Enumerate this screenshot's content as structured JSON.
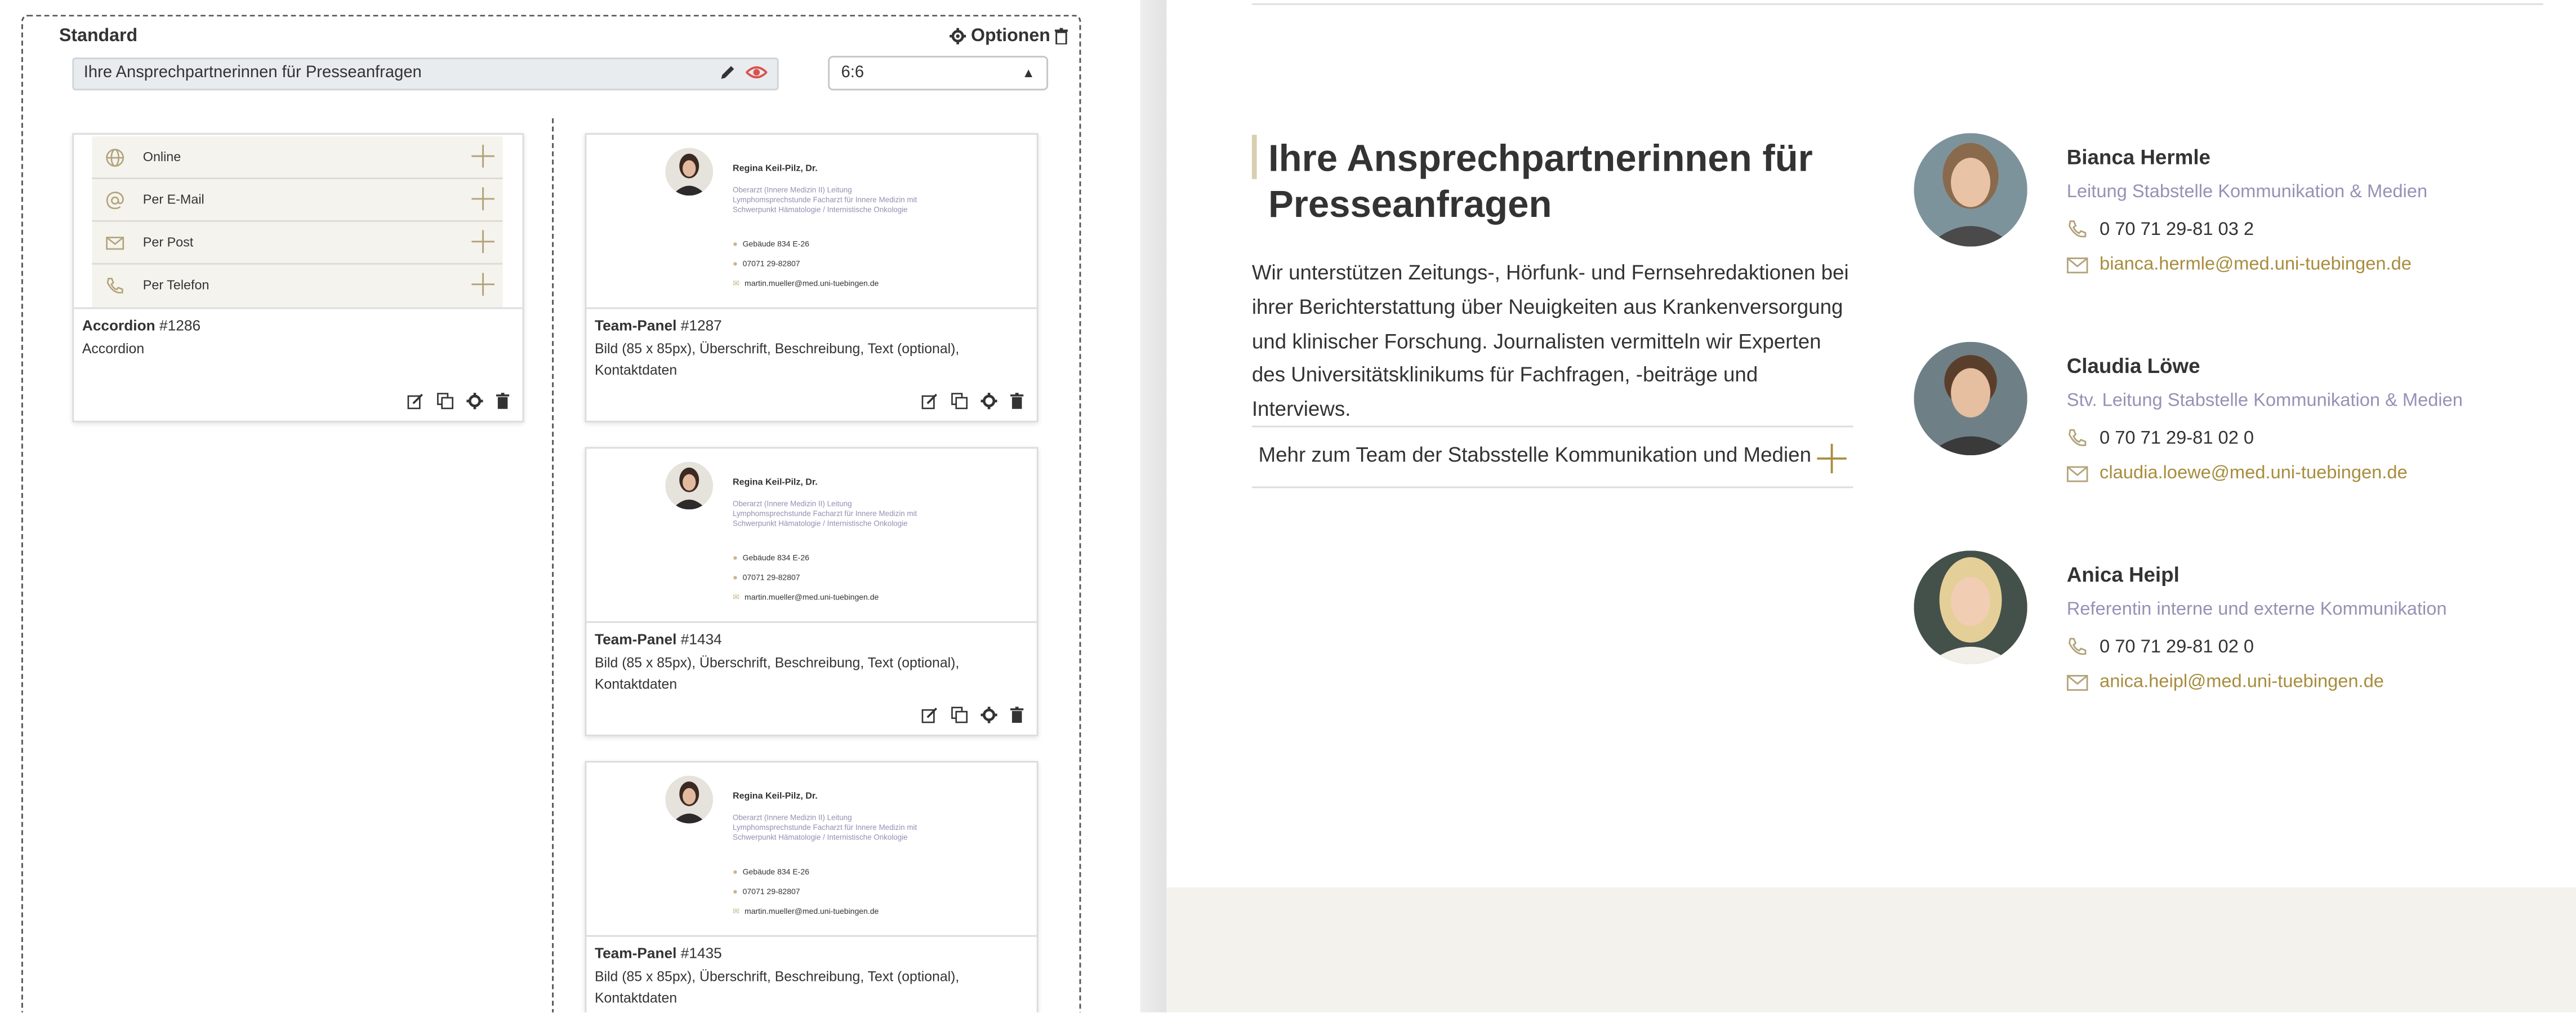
{
  "editor": {
    "grid_label": "Standard",
    "options_label": "Optionen",
    "title_value": "Ihre Ansprechpartnerinnen für Presseanfragen",
    "ratio_value": "6:6",
    "accordion_element": {
      "rows": [
        {
          "label": "Online",
          "icon": "globe-icon"
        },
        {
          "label": "Per E-Mail",
          "icon": "at-icon"
        },
        {
          "label": "Per Post",
          "icon": "envelope-icon"
        },
        {
          "label": "Per Telefon",
          "icon": "phone-icon"
        }
      ],
      "type": "Accordion",
      "id": "#1286",
      "description": "Accordion"
    },
    "team_panels": [
      {
        "type": "Team-Panel",
        "id": "#1287",
        "description": "Bild (85 x 85px), Überschrift, Beschreibung, Text (optional), Kontaktdaten",
        "preview_name": "Regina Keil-Pilz, Dr.",
        "preview_desc": "Oberarzt (Innere Medizin II) Leitung Lymphomsprechstunde Facharzt für Innere Medizin mit Schwerpunkt Hämatologie / Internistische Onkologie",
        "preview_address": "Gebäude 834 E-26",
        "preview_phone": "07071 29-82807",
        "preview_email": "martin.mueller@med.uni-tuebingen.de"
      },
      {
        "type": "Team-Panel",
        "id": "#1434",
        "description": "Bild (85 x 85px), Überschrift, Beschreibung, Text (optional), Kontaktdaten",
        "preview_name": "Regina Keil-Pilz, Dr.",
        "preview_desc": "Oberarzt (Innere Medizin II) Leitung Lymphomsprechstunde Facharzt für Innere Medizin mit Schwerpunkt Hämatologie / Internistische Onkologie",
        "preview_address": "Gebäude 834 E-26",
        "preview_phone": "07071 29-82807",
        "preview_email": "martin.mueller@med.uni-tuebingen.de"
      },
      {
        "type": "Team-Panel",
        "id": "#1435",
        "description": "Bild (85 x 85px), Überschrift, Beschreibung, Text (optional), Kontaktdaten",
        "preview_name": "Regina Keil-Pilz, Dr.",
        "preview_desc": "Oberarzt (Innere Medizin II) Leitung Lymphomsprechstunde Facharzt für Innere Medizin mit Schwerpunkt Hämatologie / Internistische Onkologie",
        "preview_address": "Gebäude 834 E-26",
        "preview_phone": "07071 29-82807",
        "preview_email": "martin.mueller@med.uni-tuebingen.de"
      }
    ]
  },
  "frontend": {
    "heading": "Ihre Ansprechpartnerinnen für Presseanfragen",
    "intro": "Wir unterstützen Zeitungs-, Hörfunk- und Fernsehredaktionen bei ihrer Berichterstattung über Neuigkeiten aus Krankenversorgung und klinischer Forschung. Journalisten vermitteln wir Experten des Universitätsklinikums für Fachfragen, -beiträge und Interviews.",
    "accordion_label": "Mehr zum Team der Stabsstelle Kommunikation und Medien",
    "contacts": [
      {
        "name": "Bianca Hermle",
        "role": "Leitung Stabstelle Kommunikation & Medien",
        "phone": "0 70 71 29-81 03 2",
        "email": "bianca.hermle@med.uni-tuebingen.de"
      },
      {
        "name": "Claudia Löwe",
        "role": "Stv. Leitung Stabstelle Kommunikation & Medien",
        "phone": "0 70 71 29-81 02 0",
        "email": "claudia.loewe@med.uni-tuebingen.de"
      },
      {
        "name": "Anica Heipl",
        "role": "Referentin interne und externe Kommunikation",
        "phone": "0 70 71 29-81 02 0",
        "email": "anica.heipl@med.uni-tuebingen.de"
      }
    ]
  },
  "colors": {
    "accent_gold": "#a88d3e",
    "role_purple": "#9592b5",
    "accordion_bg": "#f4f3ee"
  }
}
